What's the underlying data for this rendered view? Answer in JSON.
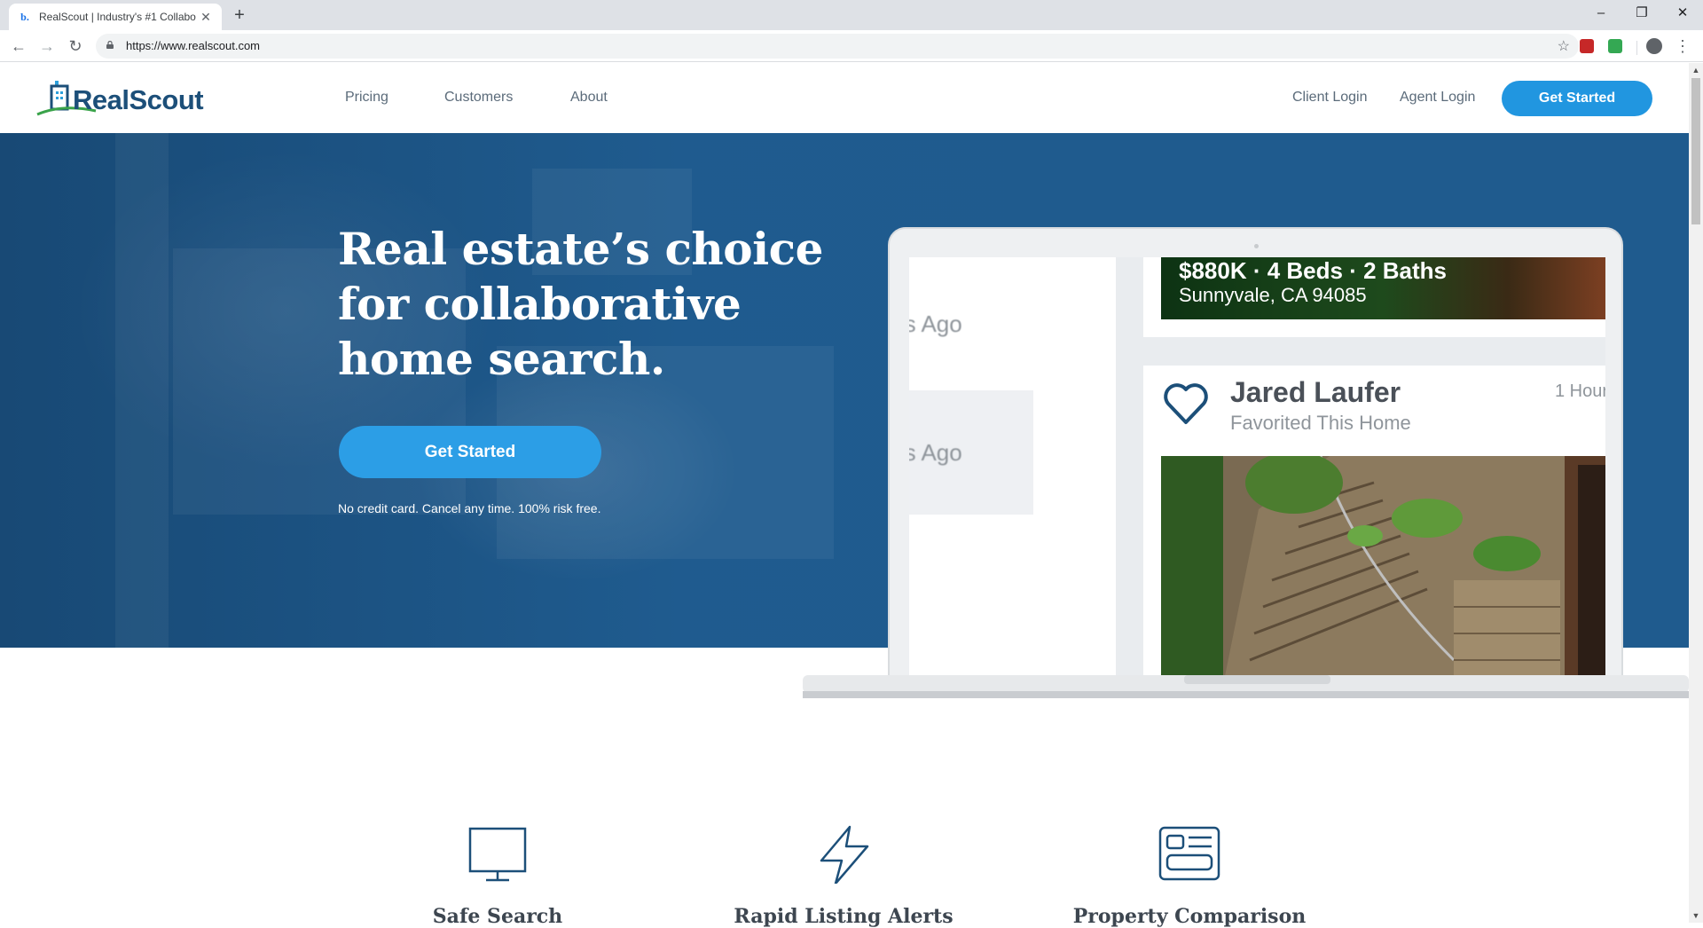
{
  "browser": {
    "tab_title": "RealScout | Industry's #1 Collabo",
    "tab_favicon": "b.",
    "new_tab": "+",
    "url": "https://www.realscout.com",
    "window_controls": {
      "minimize": "–",
      "restore": "❐",
      "close": "✕"
    },
    "extensions": [
      "red-extension-icon",
      "green-extension-icon"
    ]
  },
  "header": {
    "logo_text": "RealScout",
    "nav": {
      "pricing": "Pricing",
      "customers": "Customers",
      "about": "About",
      "client_login": "Client Login",
      "agent_login": "Agent Login"
    },
    "cta": "Get Started"
  },
  "hero": {
    "title": "Real estate’s choice for collaborative home search.",
    "cta": "Get Started",
    "note": "No credit card. Cancel any time. 100% risk free."
  },
  "device": {
    "ago_1": "rs Ago",
    "ago_2": "rs Ago",
    "listing": {
      "price": "$880K · 4 Beds · 2 Baths",
      "address": "Sunnyvale, CA  94085"
    },
    "activity": {
      "name": "Jared Laufer",
      "action": "Favorited This Home",
      "time": "1 Hour"
    }
  },
  "features": [
    {
      "label": "Safe Search",
      "icon": "monitor-icon"
    },
    {
      "label": "Rapid Listing Alerts",
      "icon": "lightning-icon"
    },
    {
      "label": "Property Comparison",
      "icon": "id-card-icon"
    }
  ],
  "colors": {
    "brand_blue": "#1c4f79",
    "cta_blue": "#2196e0",
    "hero_bg": "#1f5b8e"
  }
}
